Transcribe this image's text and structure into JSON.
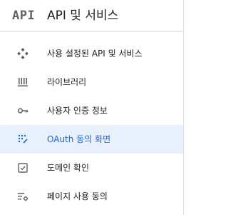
{
  "header": {
    "logo_text": "API",
    "title": "API 및 서비스"
  },
  "nav": {
    "items": [
      {
        "label": "사용 설정된 API 및 서비스",
        "icon": "dashboard-diamond-icon",
        "active": false
      },
      {
        "label": "라이브러리",
        "icon": "library-icon",
        "active": false
      },
      {
        "label": "사용자 인증 정보",
        "icon": "key-icon",
        "active": false
      },
      {
        "label": "OAuth 동의 화면",
        "icon": "oauth-dots-icon",
        "active": true
      },
      {
        "label": "도메인 확인",
        "icon": "checkbox-icon",
        "active": false
      },
      {
        "label": "페이지 사용 동의",
        "icon": "settings-list-icon",
        "active": false
      }
    ]
  },
  "colors": {
    "active_background": "#e8f0fe",
    "active_text": "#1967d2",
    "icon_gray": "#5f6368",
    "text_primary": "#202124",
    "divider": "#dadce0"
  }
}
